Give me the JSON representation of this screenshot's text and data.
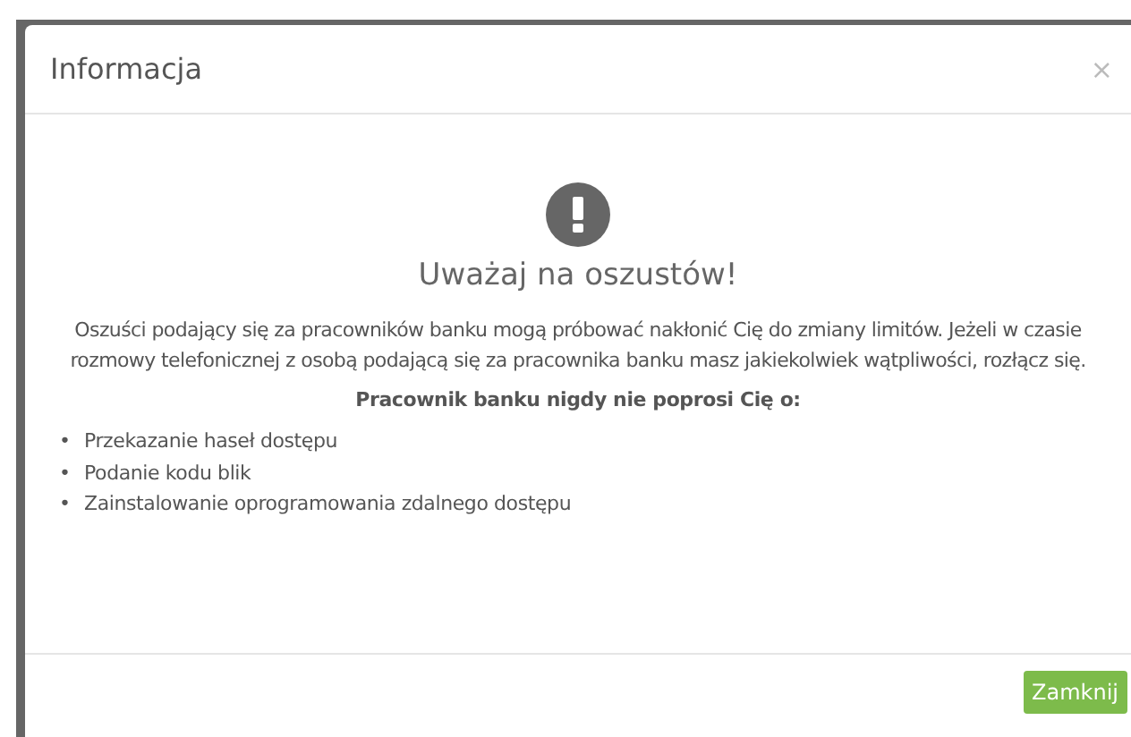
{
  "modal": {
    "title": "Informacja",
    "close": "×",
    "heading": "Uważaj na oszustów!",
    "message": "Oszuści podający się za pracowników banku mogą próbować nakłonić Cię do zmiany limitów. Jeżeli w czasie rozmowy telefonicznej z osobą podającą się za pracownika banku masz jakiekolwiek wątpliwości, rozłącz się.",
    "list_title": "Pracownik banku nigdy nie poprosi Cię o:",
    "items": [
      {
        "bullet": "•",
        "text": "Przekazanie haseł dostępu"
      },
      {
        "bullet": "•",
        "text": "Podanie kodu blik"
      },
      {
        "bullet": "•",
        "text": "Zainstalowanie oprogramowania zdalnego dostępu"
      }
    ],
    "button": "Zamknij"
  }
}
